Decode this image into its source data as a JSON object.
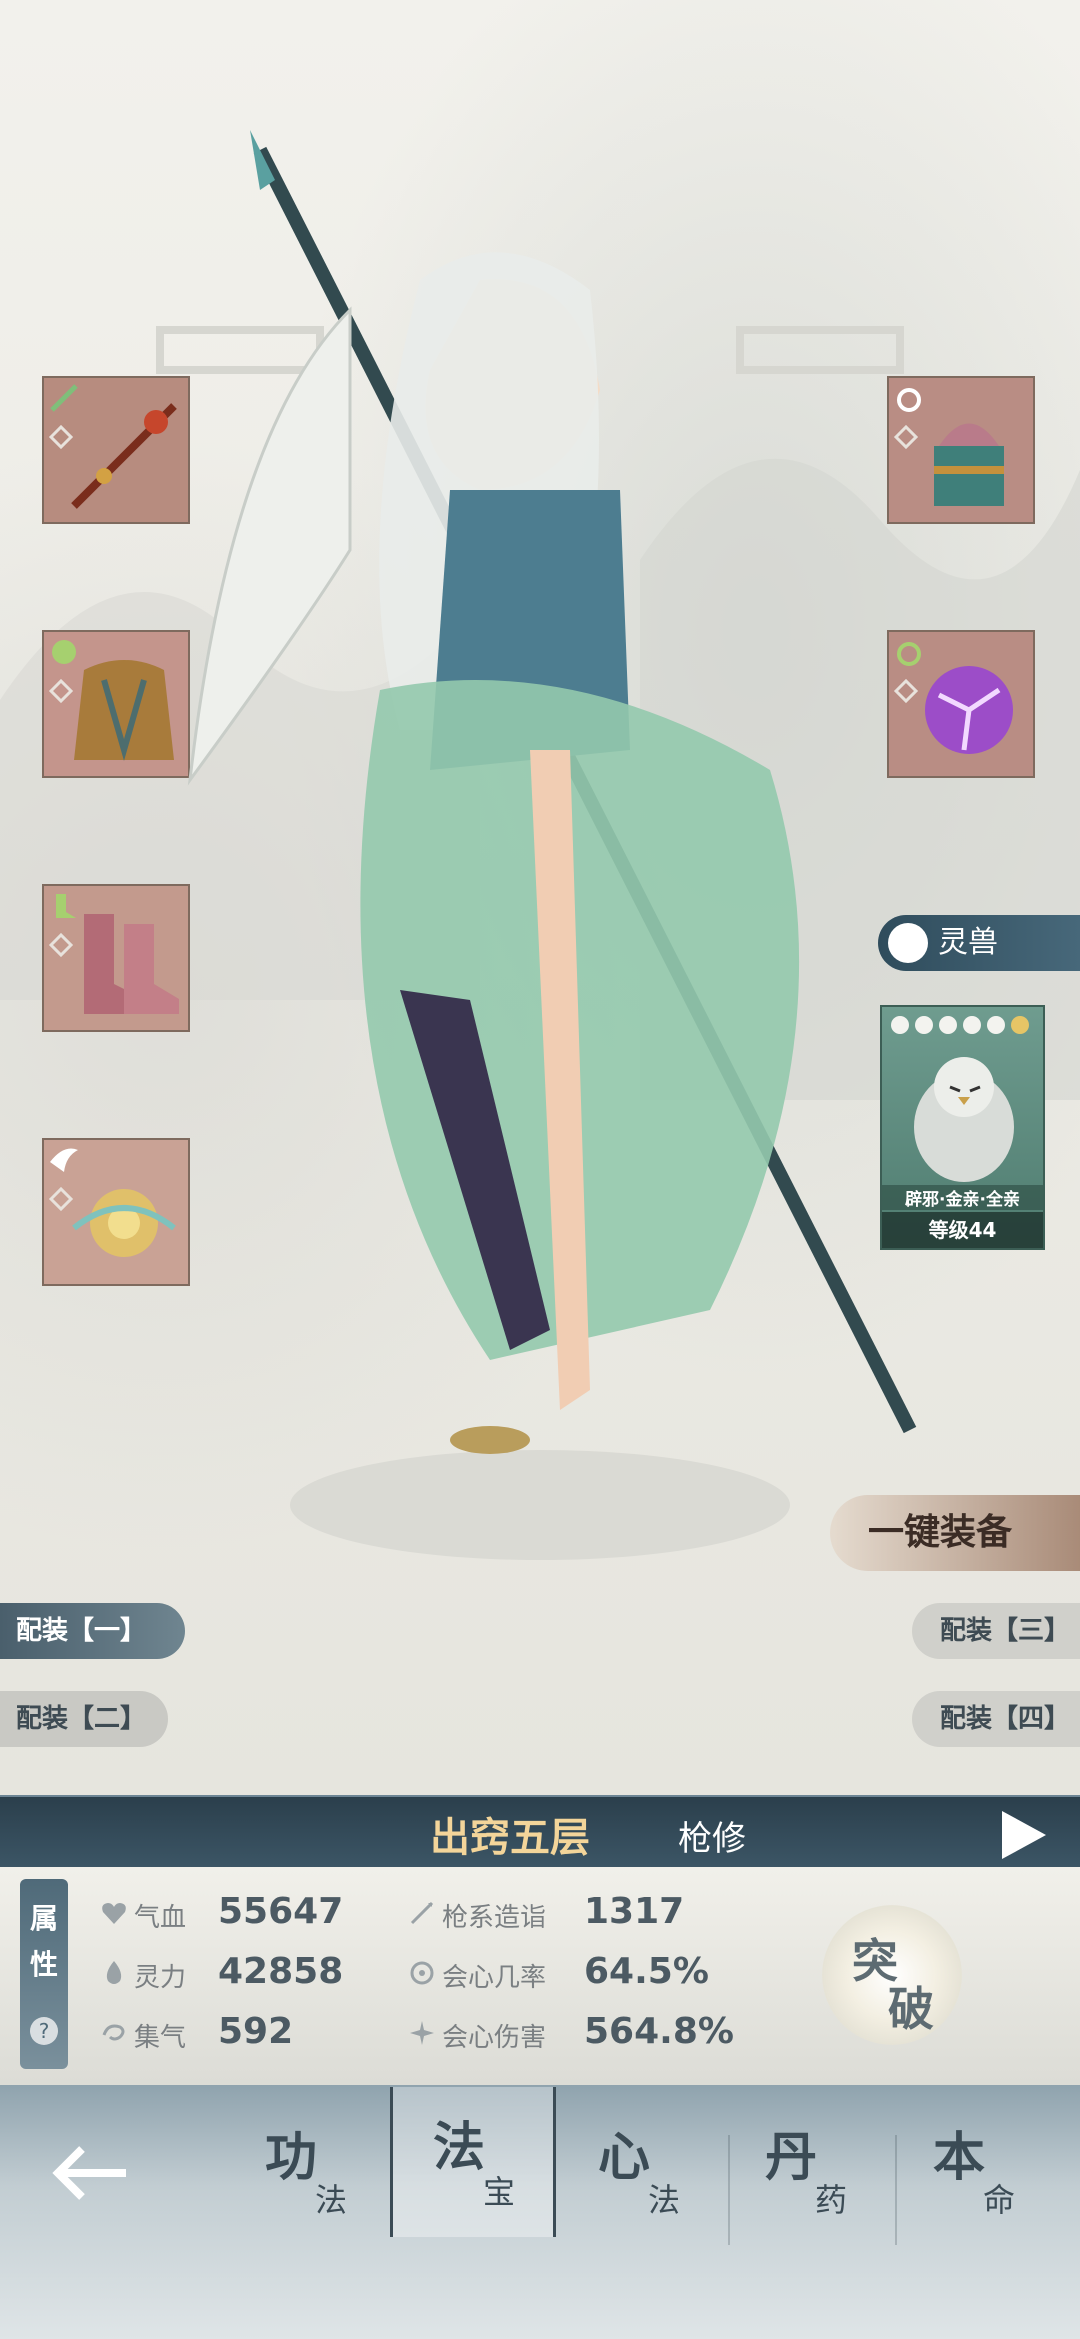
{
  "pet": {
    "tab_label": "灵兽",
    "name": "辟邪·金亲·全亲",
    "level": "等级44"
  },
  "loadouts": {
    "one": "配装【一】",
    "two": "配装【二】",
    "three": "配装【三】",
    "four": "配装【四】"
  },
  "equip_all_label": "一键装备",
  "rank": {
    "title": "出窍五层",
    "class": "枪修"
  },
  "stats_panel": {
    "side_label_1": "属",
    "side_label_2": "性",
    "help": "?",
    "hp_label": "气血",
    "hp_value": "55647",
    "spirit_label": "灵力",
    "spirit_value": "42858",
    "qi_label": "集气",
    "qi_value": "592",
    "spear_label": "枪系造诣",
    "spear_value": "1317",
    "crit_rate_label": "会心几率",
    "crit_rate_value": "64.5%",
    "crit_dmg_label": "会心伤害",
    "crit_dmg_value": "564.8%"
  },
  "breakthrough": {
    "char1": "突",
    "char2": "破"
  },
  "nav": {
    "tabs": [
      {
        "big": "功",
        "small": "法"
      },
      {
        "big": "法",
        "small": "宝"
      },
      {
        "big": "心",
        "small": "法"
      },
      {
        "big": "丹",
        "small": "药"
      },
      {
        "big": "本",
        "small": "命"
      }
    ]
  },
  "colors": {
    "accent": "#2b3f4c",
    "gold": "#f3d59a",
    "slot_bg": "#b98d84"
  }
}
